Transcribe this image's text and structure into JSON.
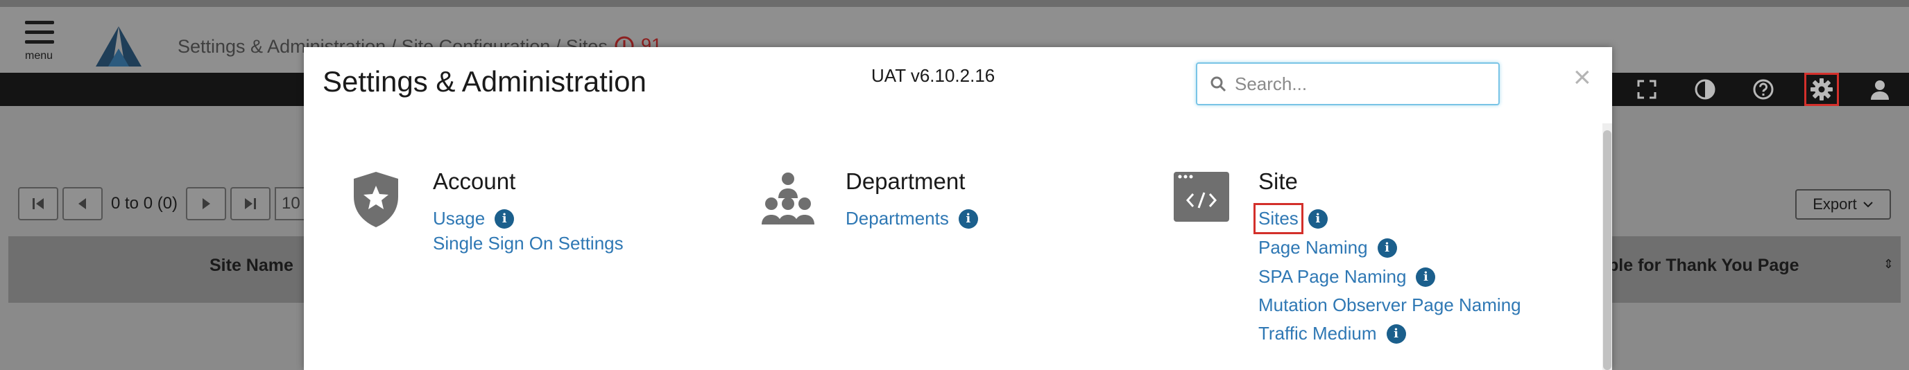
{
  "header": {
    "menu_label": "menu",
    "breadcrumb": "Settings & Administration / Site Configuration / Sites",
    "alert_count": "91"
  },
  "nav_icons": [
    "fullscreen-icon",
    "contrast-icon",
    "help-icon",
    "settings-gear-icon",
    "user-icon"
  ],
  "grid": {
    "pager_info": "0 to 0 (0)",
    "page_input": "10",
    "export_label": "Export",
    "col_site_name": "Site Name",
    "col_thank_you": "ble for Thank You Page"
  },
  "modal": {
    "title": "Settings & Administration",
    "version": "UAT v6.10.2.16",
    "search_placeholder": "Search...",
    "close_symbol": "×",
    "sections": {
      "account": {
        "heading": "Account",
        "links": [
          "Usage",
          "Single Sign On Settings"
        ]
      },
      "department": {
        "heading": "Department",
        "links": [
          "Departments"
        ]
      },
      "site": {
        "heading": "Site",
        "links": [
          "Sites",
          "Page Naming",
          "SPA Page Naming",
          "Mutation Observer Page Naming",
          "Traffic Medium"
        ]
      }
    }
  },
  "colors": {
    "accent_link": "#2f78b4",
    "info_badge": "#1b5f8c",
    "highlight": "#d3302b",
    "navbar": "#141414"
  }
}
